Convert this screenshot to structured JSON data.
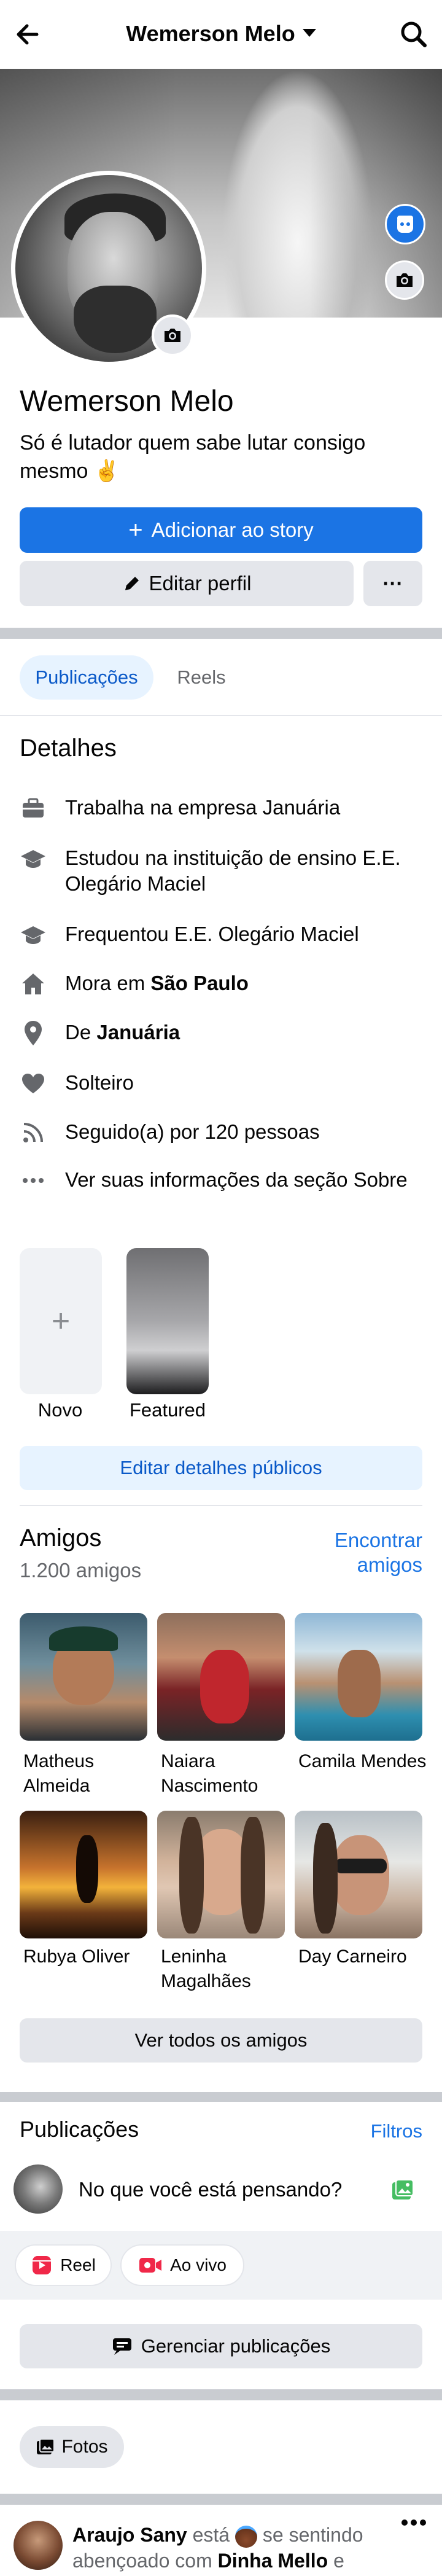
{
  "header": {
    "title": "Wemerson Melo"
  },
  "profile": {
    "name": "Wemerson Melo",
    "bio": "Só é lutador quem sabe lutar consigo mesmo ✌️",
    "add_story_label": "Adicionar ao story",
    "edit_profile_label": "Editar perfil",
    "more_label": "···"
  },
  "tabs": [
    {
      "label": "Publicações",
      "active": true
    },
    {
      "label": "Reels",
      "active": false
    }
  ],
  "details": {
    "title": "Detalhes",
    "items": [
      {
        "icon": "briefcase-icon",
        "text": "Trabalha na empresa Januária"
      },
      {
        "icon": "graduation-cap-icon",
        "text": "Estudou na instituição de ensino E.E. Olegário Maciel"
      },
      {
        "icon": "graduation-cap-icon",
        "text": "Frequentou E.E. Olegário Maciel"
      },
      {
        "icon": "home-icon",
        "prefix": "Mora em ",
        "bold": "São Paulo"
      },
      {
        "icon": "location-pin-icon",
        "prefix": "De ",
        "bold": "Januária"
      },
      {
        "icon": "heart-icon",
        "text": "Solteiro"
      },
      {
        "icon": "rss-icon",
        "text": "Seguido(a) por 120 pessoas"
      },
      {
        "icon": "ellipsis-icon",
        "text": "Ver suas informações da seção Sobre"
      }
    ]
  },
  "featured": {
    "new_label": "Novo",
    "featured_label": "Featured",
    "edit_public_label": "Editar detalhes públicos"
  },
  "friends": {
    "title": "Amigos",
    "count": "1.200 amigos",
    "find_label": "Encontrar amigos",
    "list": [
      {
        "name": "Matheus Almeida"
      },
      {
        "name": "Naiara Nascimento"
      },
      {
        "name": "Camila Mendes"
      },
      {
        "name": "Rubya Oliver"
      },
      {
        "name": "Leninha Magalhães"
      },
      {
        "name": "Day Carneiro"
      }
    ],
    "see_all_label": "Ver todos os amigos"
  },
  "posts": {
    "title": "Publicações",
    "filters_label": "Filtros",
    "composer_placeholder": "No que você está pensando?",
    "reel_label": "Reel",
    "live_label": "Ao vivo",
    "manage_label": "Gerenciar publicações",
    "photos_label": "Fotos"
  },
  "feed_post": {
    "author": "Araujo Sany",
    "mid_text": " está ",
    "feeling": " se sentindo abençoado com ",
    "tagged": "Dinha Mello",
    "tail": " e"
  },
  "colors": {
    "accent": "#1b74e4",
    "light_accent": "#e7f3ff",
    "gray_button": "#e4e6eb",
    "separator": "#c9ccd1"
  }
}
